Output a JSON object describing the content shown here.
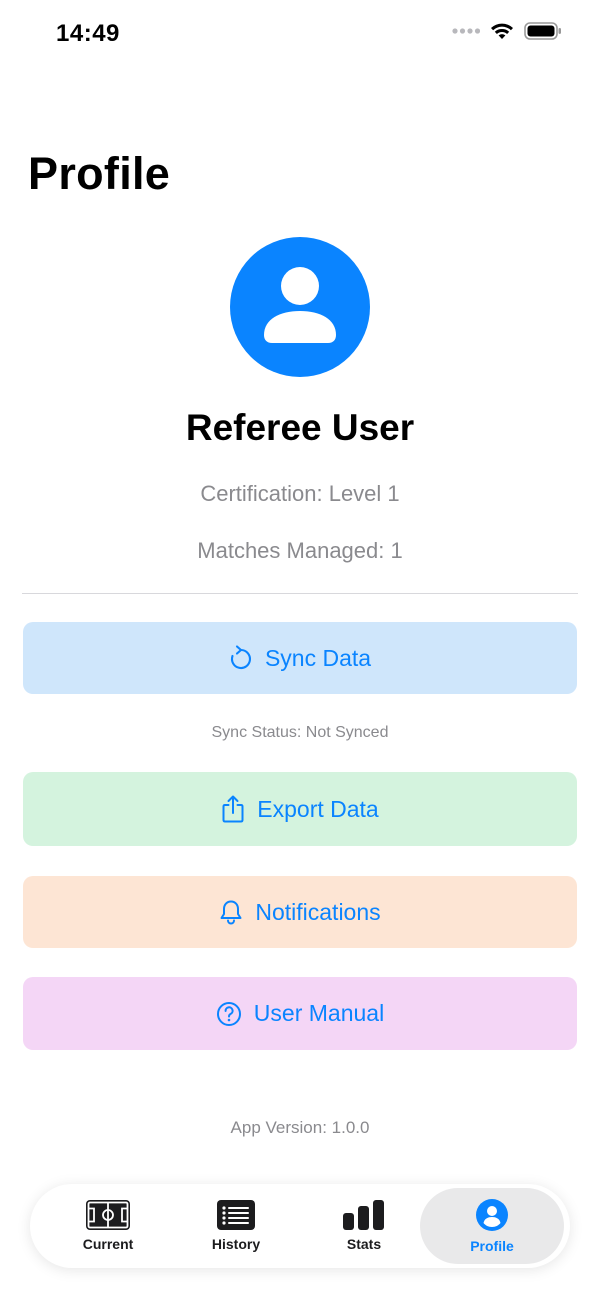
{
  "status_bar": {
    "time": "14:49"
  },
  "page": {
    "title": "Profile"
  },
  "user": {
    "name": "Referee User",
    "certification": "Certification: Level 1",
    "matches": "Matches Managed: 1",
    "avatar_icon": "person-icon"
  },
  "actions": {
    "sync": {
      "label": "Sync Data",
      "icon": "sync-icon"
    },
    "sync_status": "Sync Status: Not Synced",
    "export": {
      "label": "Export Data",
      "icon": "share-icon"
    },
    "notifications": {
      "label": "Notifications",
      "icon": "bell-icon"
    },
    "manual": {
      "label": "User Manual",
      "icon": "question-circle-icon"
    }
  },
  "app_version": "App Version: 1.0.0",
  "tabs": [
    {
      "label": "Current",
      "icon": "soccer-field-icon",
      "selected": false
    },
    {
      "label": "History",
      "icon": "list-icon",
      "selected": false
    },
    {
      "label": "Stats",
      "icon": "chart-bars-icon",
      "selected": false
    },
    {
      "label": "Profile",
      "icon": "person-circle-icon",
      "selected": true
    }
  ],
  "colors": {
    "accent": "#0a84ff",
    "sync_bg": "#cfe6fb",
    "export_bg": "#d4f3de",
    "notifications_bg": "#fde5d4",
    "manual_bg": "#f4d6f6",
    "secondary_text": "#8a8a8e"
  }
}
